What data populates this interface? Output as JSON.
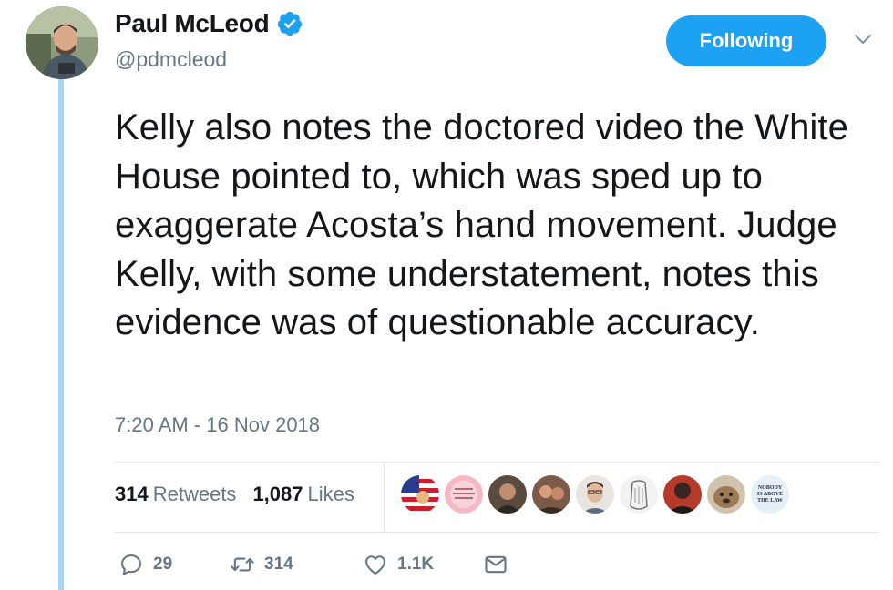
{
  "tweet": {
    "display_name": "Paul McLeod",
    "handle": "@pdmcleod",
    "follow_label": "Following",
    "text": "Kelly also notes the doctored video the White House pointed to, which was sped up to exaggerate Acosta’s hand movement. Judge Kelly, with some understatement, notes this evidence was of questionable accuracy.",
    "timestamp": "7:20 AM - 16 Nov 2018"
  },
  "stats": {
    "retweets_count": "314",
    "retweets_label": "Retweets",
    "likes_count": "1,087",
    "likes_label": "Likes"
  },
  "likers_badge": {
    "line1": "NOBODY",
    "line2": "IS ABOVE",
    "line3": "THE LAW"
  },
  "actions": {
    "replies": "29",
    "retweets": "314",
    "likes": "1.1K"
  },
  "colors": {
    "brand_blue": "#1da1f2",
    "muted_text": "#657786",
    "thread_line": "#a2d7f6"
  },
  "icons": [
    "verified-badge-icon",
    "chevron-down-icon",
    "reply-icon",
    "retweet-icon",
    "heart-icon",
    "direct-message-icon"
  ]
}
